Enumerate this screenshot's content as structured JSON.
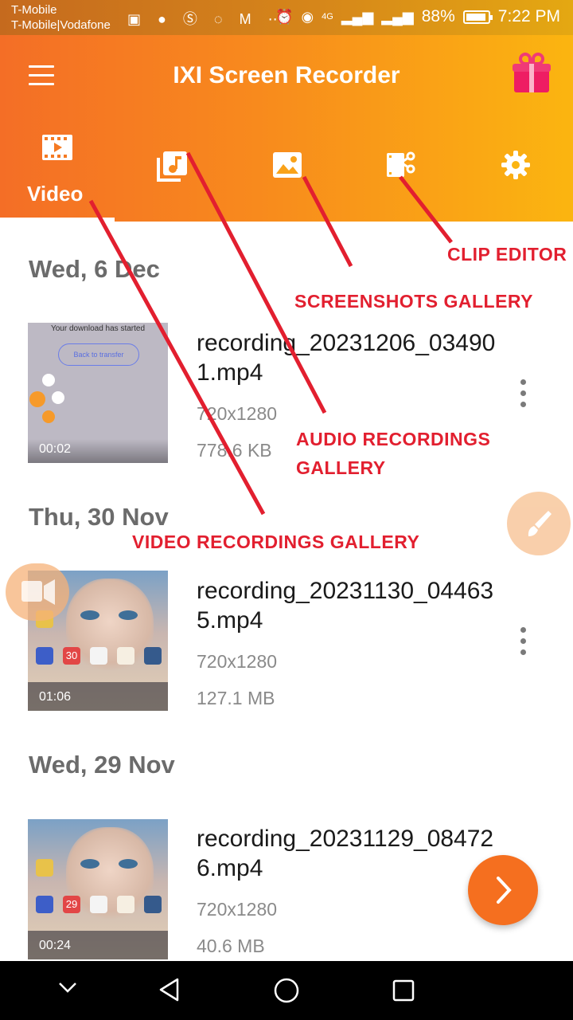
{
  "status_bar": {
    "carrier_primary": "T-Mobile",
    "carrier_secondary": "T-Mobile|Vodafone",
    "network": "4G",
    "battery": "88%",
    "time": "7:22 PM"
  },
  "app_bar": {
    "title": "IXI Screen Recorder",
    "tabs": [
      {
        "id": "video",
        "label": "Video",
        "icon": "film-icon",
        "selected": true
      },
      {
        "id": "audio",
        "label": "",
        "icon": "music-library-icon",
        "selected": false
      },
      {
        "id": "screenshots",
        "label": "",
        "icon": "image-icon",
        "selected": false
      },
      {
        "id": "editor",
        "label": "",
        "icon": "clip-scissors-icon",
        "selected": false
      },
      {
        "id": "settings",
        "label": "",
        "icon": "gear-icon",
        "selected": false
      }
    ]
  },
  "recordings": [
    {
      "date": "Wed, 6 Dec",
      "name": "recording_20231206_034901.mp4",
      "resolution": "720x1280",
      "size": "778.6 KB",
      "duration": "00:02",
      "thumb_text": "Your download has started",
      "thumb_button": "Back to transfer"
    },
    {
      "date": "Thu, 30 Nov",
      "name": "recording_20231130_044635.mp4",
      "resolution": "720x1280",
      "size": "127.1 MB",
      "duration": "01:06",
      "thumb_date": "30"
    },
    {
      "date": "Wed, 29 Nov",
      "name": "recording_20231129_084726.mp4",
      "resolution": "720x1280",
      "size": "40.6 MB",
      "duration": "00:24",
      "thumb_date": "29"
    }
  ],
  "annotations": {
    "clip_editor": "CLIP EDITOR",
    "screenshots_gallery": "SCREENSHOTS GALLERY",
    "audio_line1": "AUDIO RECORDINGS",
    "audio_line2": "GALLERY",
    "video_gallery": "VIDEO RECORDINGS GALLERY"
  },
  "colors": {
    "accent_orange": "#f56f1f",
    "header_gradient_start": "#f46e26",
    "header_gradient_end": "#fbb510",
    "annotation_red": "#e21f2f"
  }
}
